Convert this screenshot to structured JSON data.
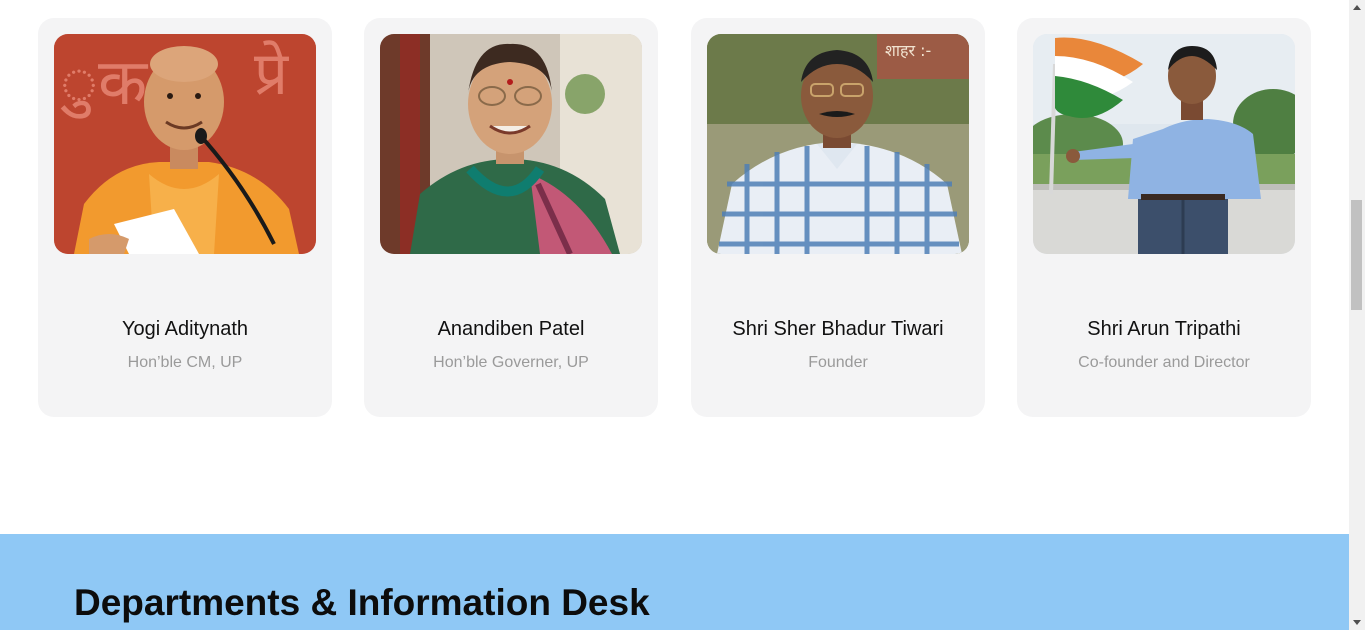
{
  "team": [
    {
      "name": "Yogi Aditynath",
      "role": "Hon’ble CM, UP",
      "photo_alt": "Photo of Yogi Aditynath"
    },
    {
      "name": "Anandiben Patel",
      "role": "Hon’ble Governer, UP",
      "photo_alt": "Photo of Anandiben Patel"
    },
    {
      "name": "Shri Sher Bhadur Tiwari",
      "role": "Founder",
      "photo_alt": "Photo of Shri Sher Bhadur Tiwari"
    },
    {
      "name": "Shri Arun Tripathi",
      "role": "Co-founder and Director",
      "photo_alt": "Photo of Shri Arun Tripathi"
    }
  ],
  "departments": {
    "title": "Departments & Information Desk"
  },
  "colors": {
    "card_bg": "#f4f4f5",
    "band_bg": "#8fc8f5",
    "role_text": "#9a9a9a"
  },
  "icons": {
    "scroll_up": "chevron-up-icon",
    "scroll_down": "chevron-down-icon"
  }
}
